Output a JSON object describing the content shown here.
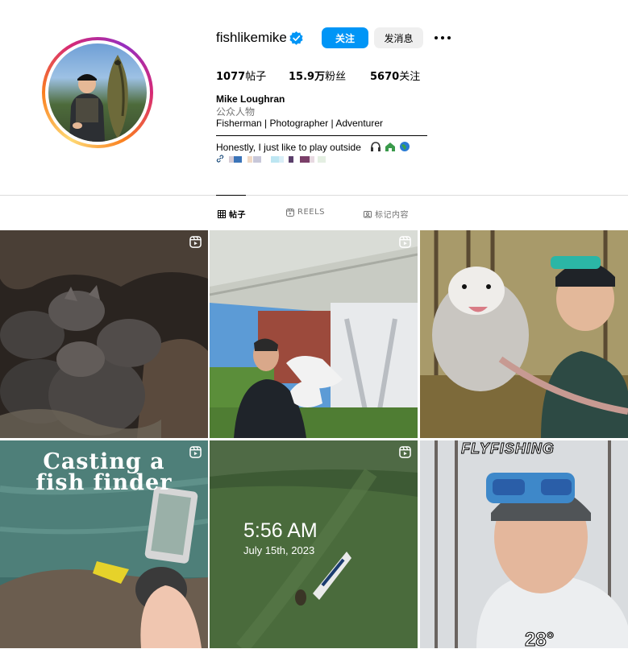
{
  "profile": {
    "username": "fishlikemike",
    "follow_label": "关注",
    "message_label": "发消息",
    "posts_count": "1077",
    "posts_label": "帖子",
    "followers_count": "15.9万",
    "followers_label": "粉丝",
    "following_count": "5670",
    "following_label": "关注",
    "full_name": "Mike Loughran",
    "category": "公众人物",
    "bio_line1": "Fisherman | Photographer | Adventurer",
    "bio_line2": "Honestly, I just like to play outside"
  },
  "tabs": [
    {
      "label": "帖子",
      "icon": "grid-icon"
    },
    {
      "label": "REELS",
      "icon": "reels-icon"
    },
    {
      "label": "标记内容",
      "icon": "tagged-icon"
    }
  ],
  "posts": [
    {
      "kind": "reel"
    },
    {
      "kind": "reel"
    },
    {
      "kind": "reel"
    },
    {
      "kind": "reel",
      "overlay_line1": "Casting a",
      "overlay_line2": "fish finder"
    },
    {
      "kind": "reel",
      "overlay_time": "5:56 AM",
      "overlay_date": "July 15th, 2023"
    },
    {
      "kind": "reel",
      "overlay_title": "FLYFISHING",
      "overlay_temp": "28°"
    }
  ],
  "colors": {
    "accent": "#0095f6",
    "secondary_button": "#efefef",
    "muted_text": "#737373",
    "divider": "#dbdbdb"
  }
}
